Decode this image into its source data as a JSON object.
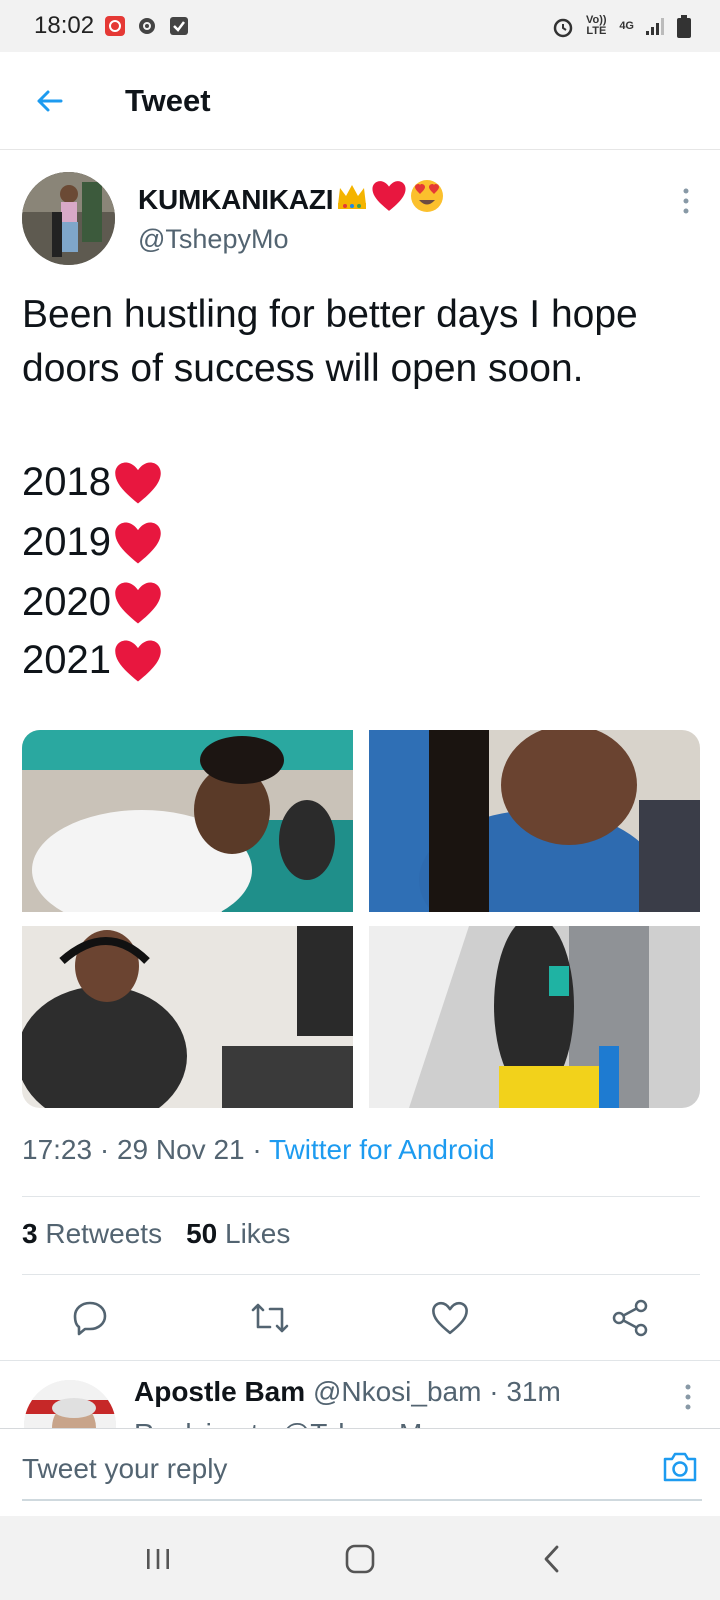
{
  "status_bar": {
    "time": "18:02",
    "volte": "Vo)) LTE",
    "network": "4G",
    "icons": [
      "notification-icon",
      "gear-icon",
      "checkbox-icon",
      "alarm-icon",
      "signal-icon",
      "battery-icon"
    ]
  },
  "header": {
    "title": "Tweet"
  },
  "tweet": {
    "display_name": "KUMKANIKAZI",
    "username": "@TshepyMo",
    "text": "Been hustling for better days I hope doors of success will open soon.",
    "years": [
      "2018",
      "2019",
      "2020",
      "2021"
    ],
    "time": "17:23",
    "date": "29 Nov 21",
    "source": "Twitter for Android",
    "separator": "·",
    "retweets_count": "3",
    "retweets_label": "Retweets",
    "likes_count": "50",
    "likes_label": "Likes"
  },
  "reply_preview": {
    "name": "Apostle Bam",
    "handle": "@Nkosi_bam",
    "time": "31m",
    "text": "Replying to @TshepyMo"
  },
  "composer": {
    "placeholder": "Tweet your reply"
  },
  "colors": {
    "accent": "#1d9bf0",
    "heart": "#e0245e",
    "text": "#0f1419",
    "muted": "#536471"
  }
}
